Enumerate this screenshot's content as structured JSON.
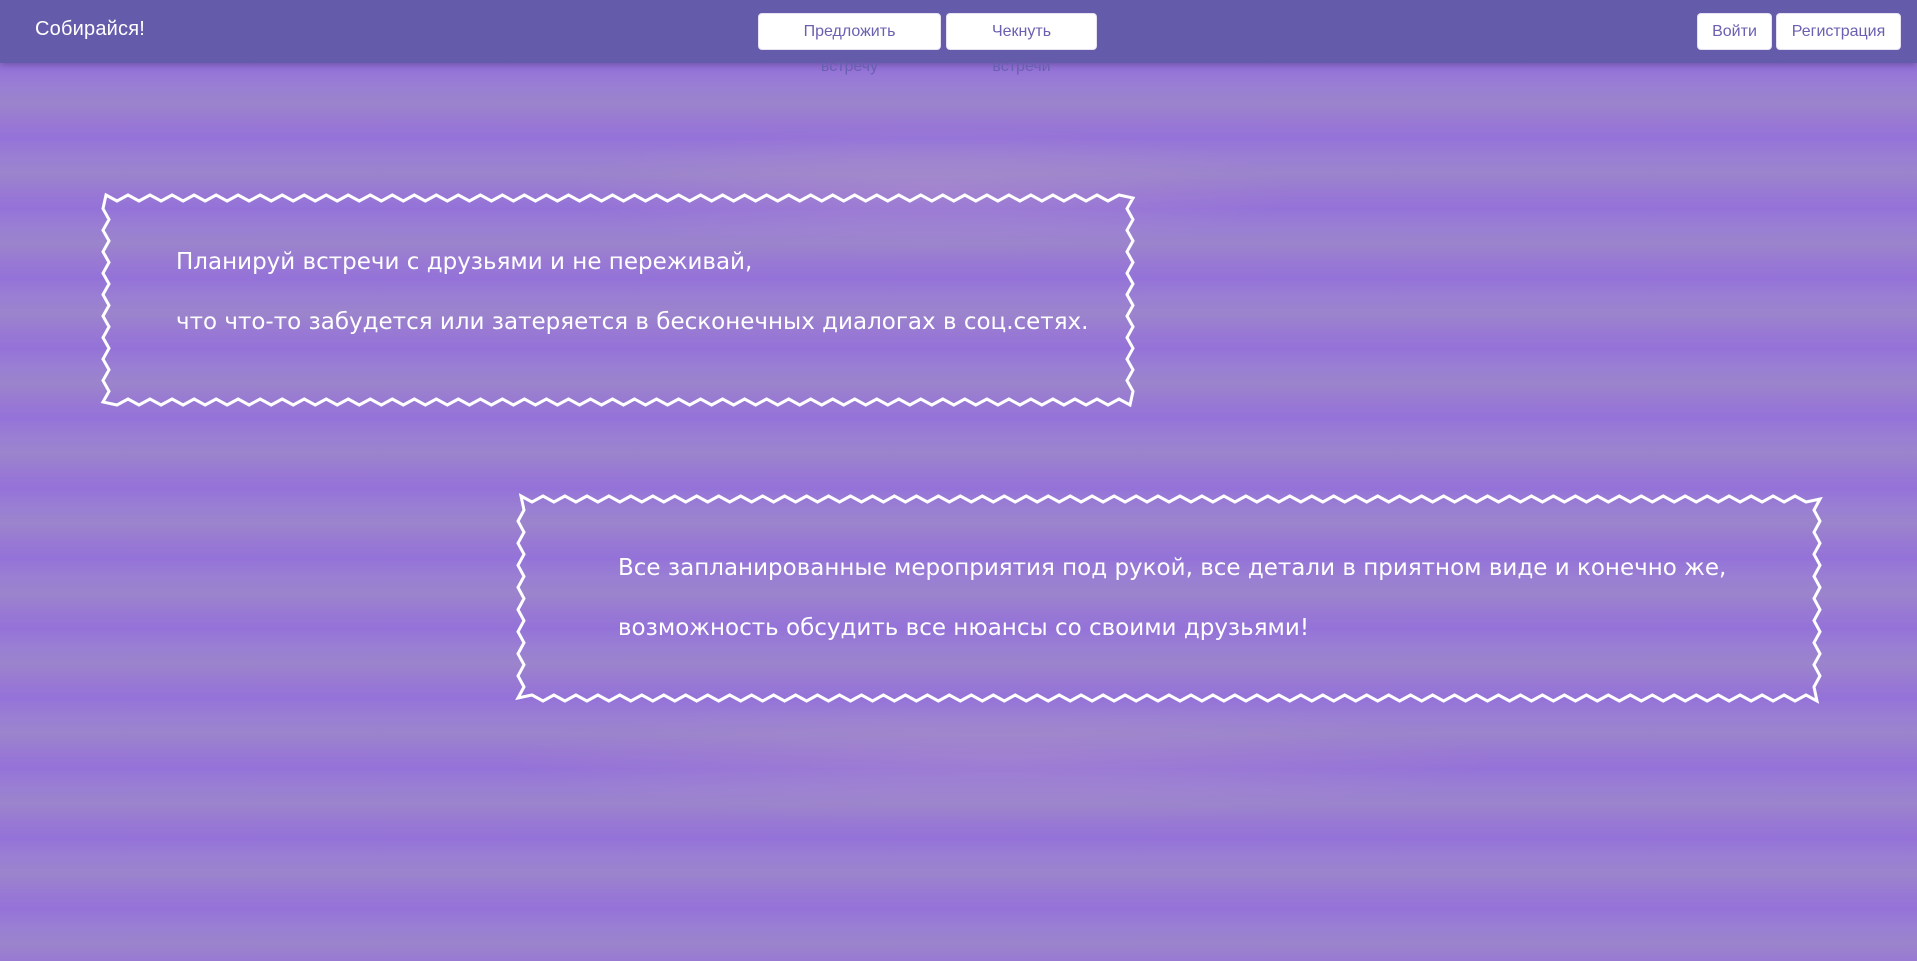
{
  "header": {
    "brand": "Собирайся!",
    "nav": {
      "propose_label": "Предложить встречу",
      "check_label": "Чекнуть встречи"
    },
    "auth": {
      "login_label": "Войти",
      "register_label": "Регистрация"
    }
  },
  "main": {
    "blocks": [
      {
        "lines": [
          "Планируй встречи с друзьями и не переживай,",
          "что что-то забудется или затеряется в бесконечных диалогах в соц.сетях."
        ]
      },
      {
        "lines": [
          "Все запланированные мероприятия под рукой, все детали в приятном виде и конечно же,",
          "возможность обсудить все нюансы со своими друзьями!"
        ]
      }
    ]
  },
  "colors": {
    "navbar": "#645cab",
    "background": "#9674d6",
    "button_text": "#6a60b0",
    "frame_stroke": "#ffffff"
  }
}
